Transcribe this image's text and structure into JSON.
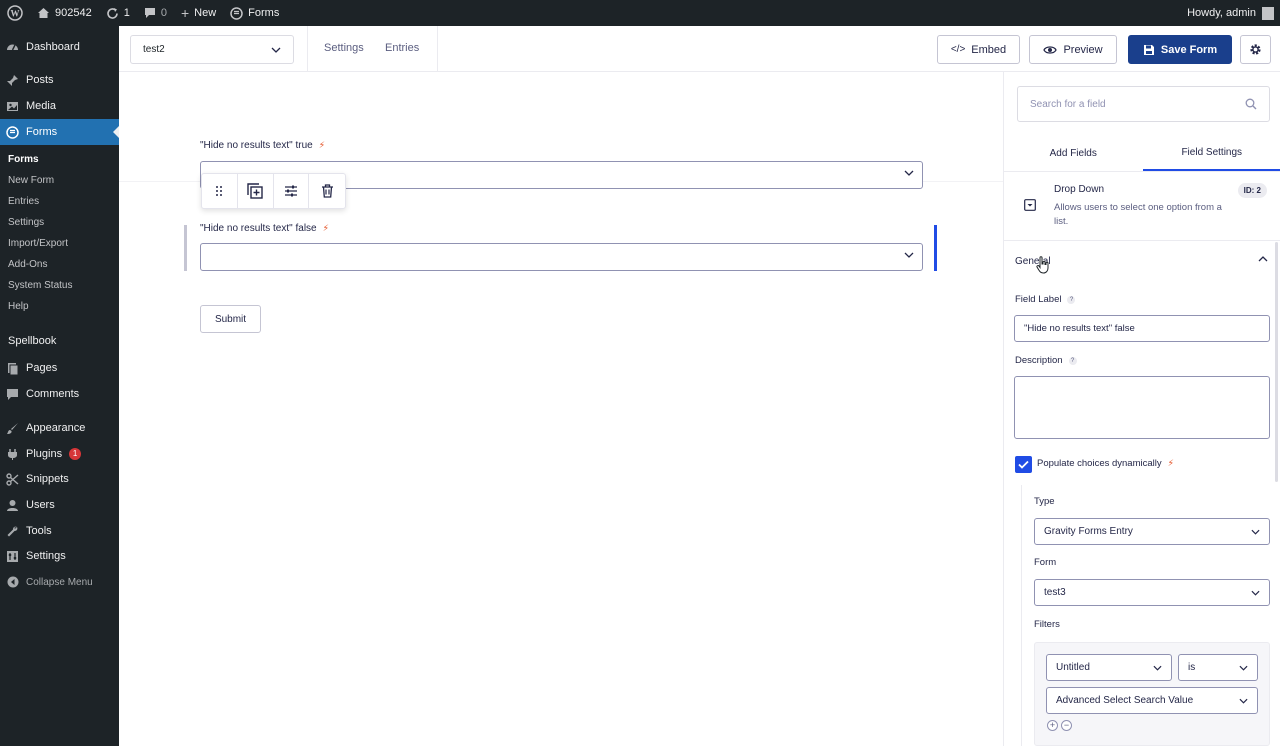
{
  "admin_bar": {
    "site_name": "902542",
    "updates_count": "1",
    "comments_count": "0",
    "new_label": "New",
    "forms_label": "Forms",
    "howdy": "Howdy, admin"
  },
  "sidebar": {
    "items": [
      {
        "label": "Dashboard",
        "icon": "dashboard-icon"
      },
      {
        "label": "Posts",
        "icon": "pin-icon"
      },
      {
        "label": "Media",
        "icon": "media-icon"
      },
      {
        "label": "Forms",
        "icon": "forms-icon"
      },
      {
        "label": "Spellbook"
      },
      {
        "label": "Pages",
        "icon": "pages-icon"
      },
      {
        "label": "Comments",
        "icon": "comment-icon"
      },
      {
        "label": "Appearance",
        "icon": "brush-icon"
      },
      {
        "label": "Plugins",
        "icon": "plugin-icon",
        "badge": "1"
      },
      {
        "label": "Snippets",
        "icon": "snippets-icon"
      },
      {
        "label": "Users",
        "icon": "user-icon"
      },
      {
        "label": "Tools",
        "icon": "wrench-icon"
      },
      {
        "label": "Settings",
        "icon": "settings-icon"
      }
    ],
    "submenu": [
      "Forms",
      "New Form",
      "Entries",
      "Settings",
      "Import/Export",
      "Add-Ons",
      "System Status",
      "Help"
    ],
    "collapse_label": "Collapse Menu"
  },
  "toolbar": {
    "form_name": "test2",
    "settings_label": "Settings",
    "entries_label": "Entries",
    "embed_label": "Embed",
    "preview_label": "Preview",
    "save_label": "Save Form"
  },
  "canvas": {
    "field1_label": "\"Hide no results text\" true",
    "field2_label": "\"Hide no results text\" false",
    "submit_label": "Submit"
  },
  "panel": {
    "search_placeholder": "Search for a field",
    "tab_add": "Add Fields",
    "tab_settings": "Field Settings",
    "field_type": "Drop Down",
    "field_desc": "Allows users to select one option from a list.",
    "field_id": "ID: 2",
    "section_general": "General",
    "field_label_label": "Field Label",
    "field_label_value": "\"Hide no results text\" false",
    "description_label": "Description",
    "populate_label": "Populate choices dynamically",
    "type_label": "Type",
    "type_value": "Gravity Forms Entry",
    "form_label": "Form",
    "form_value": "test3",
    "filters_label": "Filters",
    "filter_field": "Untitled",
    "filter_operator": "is",
    "filter_value": "Advanced Select Search Value"
  },
  "colors": {
    "admin_dark": "#1d2327",
    "active_blue": "#2271b1",
    "gf_blue": "#204ce5",
    "bolt_orange": "#e5592e"
  }
}
